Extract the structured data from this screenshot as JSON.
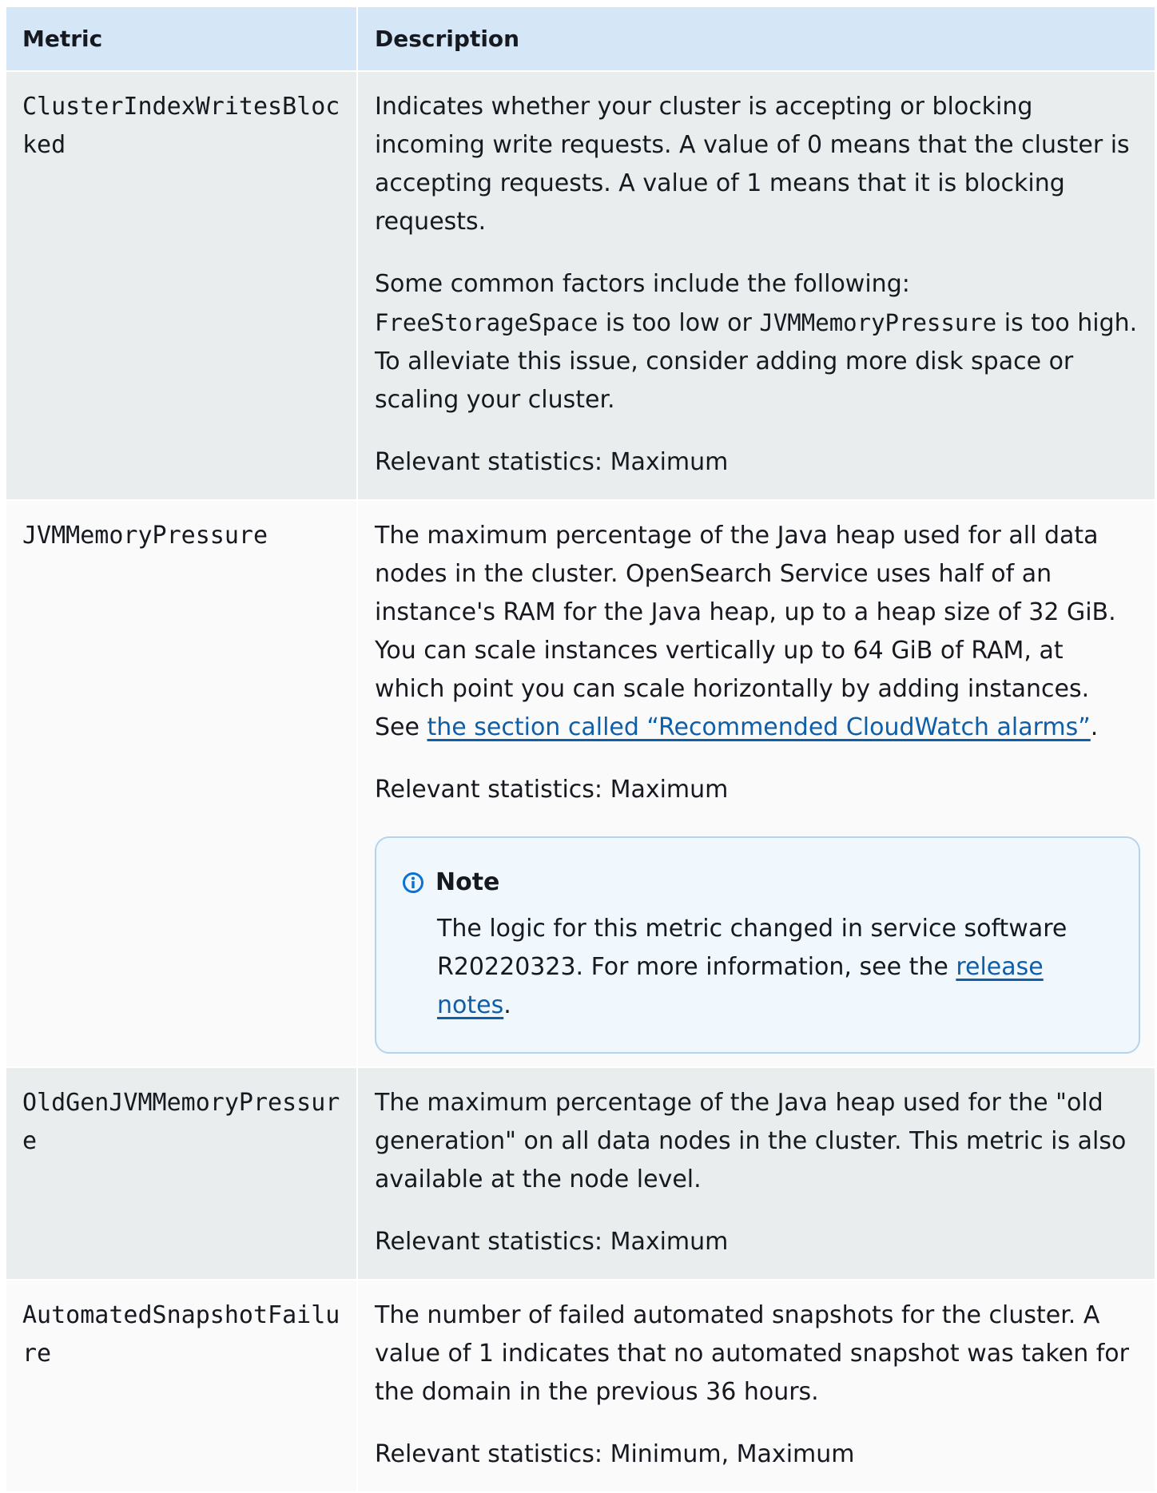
{
  "table": {
    "headers": {
      "metric": "Metric",
      "description": "Description"
    },
    "rows": [
      {
        "metric": "ClusterIndexWritesBlocked",
        "p1": "Indicates whether your cluster is accepting or blocking incoming write requests. A value of 0 means that the cluster is accepting  requests. A value of 1 means that it is blocking requests.",
        "p2_a": "Some common factors include the following: ",
        "p2_code1": "FreeStorageSpace",
        "p2_b": " is too low or ",
        "p2_code2": "JVMMemoryPressure",
        "p2_c": " is too high. To alleviate this issue, consider adding more disk space or scaling your cluster.",
        "stats": "Relevant statistics: Maximum"
      },
      {
        "metric": "JVMMemoryPressure",
        "p1_a": "The maximum percentage of the Java heap used for all data nodes in the cluster. OpenSearch Service uses half of an instance's RAM for the Java heap, up to a heap size of 32 GiB. You can scale instances vertically up to 64 GiB of RAM, at which point you can scale horizontally by adding instances. See ",
        "p1_link": "the section called “Recommended CloudWatch alarms”",
        "p1_b": ".",
        "stats": "Relevant statistics: Maximum",
        "note": {
          "title": "Note",
          "icon": "info-icon",
          "body_a": "The logic for this metric changed in service software R20220323. For more information, see the ",
          "link": "release notes",
          "body_b": "."
        }
      },
      {
        "metric": "OldGenJVMMemoryPressure",
        "p1": "The maximum percentage of the Java heap used for the \"old generation\" on all data nodes in the cluster. This metric is also available at the node level.",
        "stats": "Relevant statistics: Maximum"
      },
      {
        "metric": "AutomatedSnapshotFailure",
        "p1": "The number of failed automated snapshots for the cluster. A value of 1 indicates that no automated snapshot was taken for the domain in the previous 36 hours.",
        "stats": "Relevant statistics: Minimum, Maximum"
      }
    ]
  },
  "colors": {
    "header_bg": "#d5e6f7",
    "row_odd_bg": "#eaeded",
    "row_even_bg": "#fafafa",
    "link": "#0f5ea8",
    "note_border": "#b4d3ec",
    "note_icon": "#0972d3"
  }
}
